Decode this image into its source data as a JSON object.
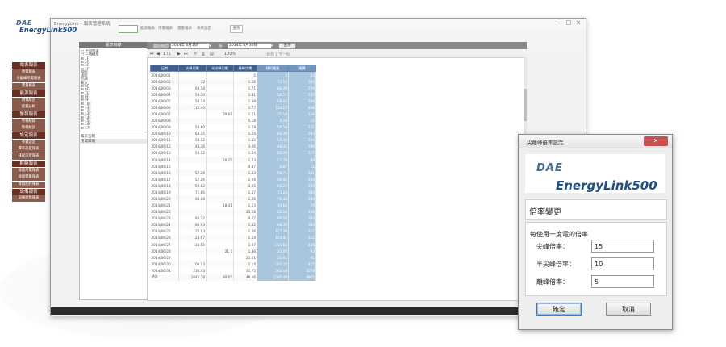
{
  "app": {
    "window_title": "EnergyLink – 報表管理系統",
    "logo_brand": "DAE",
    "logo_product": "EnergyLink500",
    "header_labels": [
      "能源報表",
      "用電報表",
      "需量報表",
      "系統設定"
    ],
    "header_button": "查詢"
  },
  "nav": [
    {
      "type": "h",
      "label": "電表報表"
    },
    {
      "type": "s",
      "label": "用電報表"
    },
    {
      "type": "s",
      "label": "尖離峰用電報表"
    },
    {
      "type": "s",
      "label": "需量報表"
    },
    {
      "type": "h",
      "label": "能源報表"
    },
    {
      "type": "s",
      "label": "用電統計"
    },
    {
      "type": "s",
      "label": "能耗分析"
    },
    {
      "type": "h",
      "label": "警報報表"
    },
    {
      "type": "s",
      "label": "警報紀錄"
    },
    {
      "type": "s",
      "label": "警報統計"
    },
    {
      "type": "h",
      "label": "設定報表"
    },
    {
      "type": "s",
      "label": "參數設定"
    },
    {
      "type": "s",
      "label": "費率設定報表"
    },
    {
      "type": "s",
      "label": "排程設定報表"
    },
    {
      "type": "h",
      "label": "群組報表"
    },
    {
      "type": "s",
      "label": "群組用電報表"
    },
    {
      "type": "s",
      "label": "群組需量報表"
    },
    {
      "type": "s",
      "label": "群組能耗報表"
    },
    {
      "type": "h",
      "label": "設備報表"
    },
    {
      "type": "s",
      "label": "設備狀態報表"
    }
  ],
  "tree": {
    "title": "電表目錄",
    "items": [
      "□ 全部電表",
      "  □ 一號機房",
      "    ⊞ 1F",
      "    ⊞ 2F",
      "    ⊞ 3F",
      "    ⊟ 4F",
      "        照明",
      "        插座",
      "        空調",
      "        動力",
      "    ⊞ 5F",
      "    ⊞ 6F",
      "    ⊞ 7F",
      "    ⊞ 8F",
      "    ⊞ 9F",
      "    ⊞ 10F",
      "    ⊞ 11F",
      "    ⊞ 12F",
      "    ⊞ 13F",
      "    ⊞ 14F",
      "    ⊞ 15F",
      "    ⊞ 16F",
      "    ⊞ 17F"
    ],
    "prop_title": "報表名稱",
    "prop_value": "用電日報"
  },
  "report": {
    "start_label": "開始時間",
    "start_date": "2014年 6月1日",
    "end_label": "至",
    "end_date": "2014年 6月30日",
    "query": "查詢",
    "toolbar_page": "1 /1",
    "toolbar_zoom": "100%",
    "toolbar_find": "尋找 | 下一個",
    "columns": [
      "日期",
      "尖峰用電",
      "半尖峰用電",
      "離峰用電",
      "總用電量",
      "電費"
    ],
    "rows": [
      [
        "2014/06/01",
        "",
        "",
        "5",
        "5",
        "23"
      ],
      [
        "2014/06/02",
        "72",
        "",
        "1.16",
        "73.16",
        "300"
      ],
      [
        "2014/06/03",
        "64.58",
        "",
        "1.71",
        "66.29",
        "274"
      ],
      [
        "2014/06/04",
        "54.30",
        "",
        "1.81",
        "56.11",
        "232"
      ],
      [
        "2014/06/05",
        "56.14",
        "",
        "1.89",
        "58.03",
        "240"
      ],
      [
        "2014/06/06",
        "112.40",
        "",
        "1.77",
        "114.17",
        "468"
      ],
      [
        "2014/06/07",
        "",
        "29.68",
        "1.51",
        "31.19",
        "126"
      ],
      [
        "2014/06/08",
        "",
        "",
        "5.18",
        "5.18",
        "22"
      ],
      [
        "2014/06/09",
        "54.60",
        "",
        "1.58",
        "56.18",
        "231"
      ],
      [
        "2014/06/10",
        "63.15",
        "",
        "1.24",
        "64.39",
        "264"
      ],
      [
        "2014/06/11",
        "58.12",
        "",
        "1.32",
        "59.44",
        "244"
      ],
      [
        "2014/06/12",
        "43.36",
        "",
        "3.06",
        "46.42",
        "190"
      ],
      [
        "2014/06/13",
        "54.12",
        "",
        "1.24",
        "55.36",
        "227"
      ],
      [
        "2014/06/14",
        "",
        "20.25",
        "1.53",
        "21.78",
        "88"
      ],
      [
        "2014/06/15",
        "",
        "",
        "4.87",
        "4.87",
        "21"
      ],
      [
        "2014/06/16",
        "57.28",
        "",
        "1.43",
        "58.71",
        "241"
      ],
      [
        "2014/06/17",
        "57.26",
        "",
        "2.66",
        "59.92",
        "246"
      ],
      [
        "2014/06/18",
        "59.62",
        "",
        "3.65",
        "63.27",
        "259"
      ],
      [
        "2014/06/19",
        "71.86",
        "",
        "1.37",
        "73.23",
        "300"
      ],
      [
        "2014/06/20",
        "68.88",
        "",
        "1.56",
        "70.44",
        "289"
      ],
      [
        "2014/06/21",
        "",
        "18.41",
        "1.23",
        "19.64",
        "79"
      ],
      [
        "2014/06/22",
        "",
        "",
        "25.16",
        "25.16",
        "106"
      ],
      [
        "2014/06/23",
        "84.22",
        "",
        "4.37",
        "88.59",
        "364"
      ],
      [
        "2014/06/24",
        "86.93",
        "",
        "1.42",
        "88.35",
        "363"
      ],
      [
        "2014/06/25",
        "125.93",
        "",
        "1.36",
        "127.29",
        "522"
      ],
      [
        "2014/06/26",
        "123.67",
        "",
        "1.24",
        "124.91",
        "512"
      ],
      [
        "2014/06/27",
        "110.55",
        "",
        "1.07",
        "111.62",
        "458"
      ],
      [
        "2014/06/28",
        "",
        "21.7",
        "1.36",
        "23.06",
        "93"
      ],
      [
        "2014/06/29",
        "",
        "",
        "21.61",
        "21.61",
        "91"
      ],
      [
        "2014/06/30",
        "100.13",
        "",
        "1.14",
        "101.27",
        "415"
      ],
      [
        "2014/06/31",
        "230.43",
        "",
        "31.75",
        "262.18",
        "1078"
      ],
      [
        "總計",
        "2046.78",
        "90.05",
        "48.66",
        "2185.49",
        "8965"
      ]
    ]
  },
  "dialog": {
    "title": "尖離峰倍率設定",
    "close": "✕",
    "logo_brand": "DAE",
    "logo_product": "EnergyLink500",
    "section": "倍率變更",
    "form_title": "每使用一度電的倍率",
    "fields": [
      {
        "label": "尖峰倍率：",
        "value": "15"
      },
      {
        "label": "半尖峰倍率：",
        "value": "10"
      },
      {
        "label": "離峰倍率：",
        "value": "5"
      }
    ],
    "ok": "確定",
    "cancel": "取消"
  }
}
